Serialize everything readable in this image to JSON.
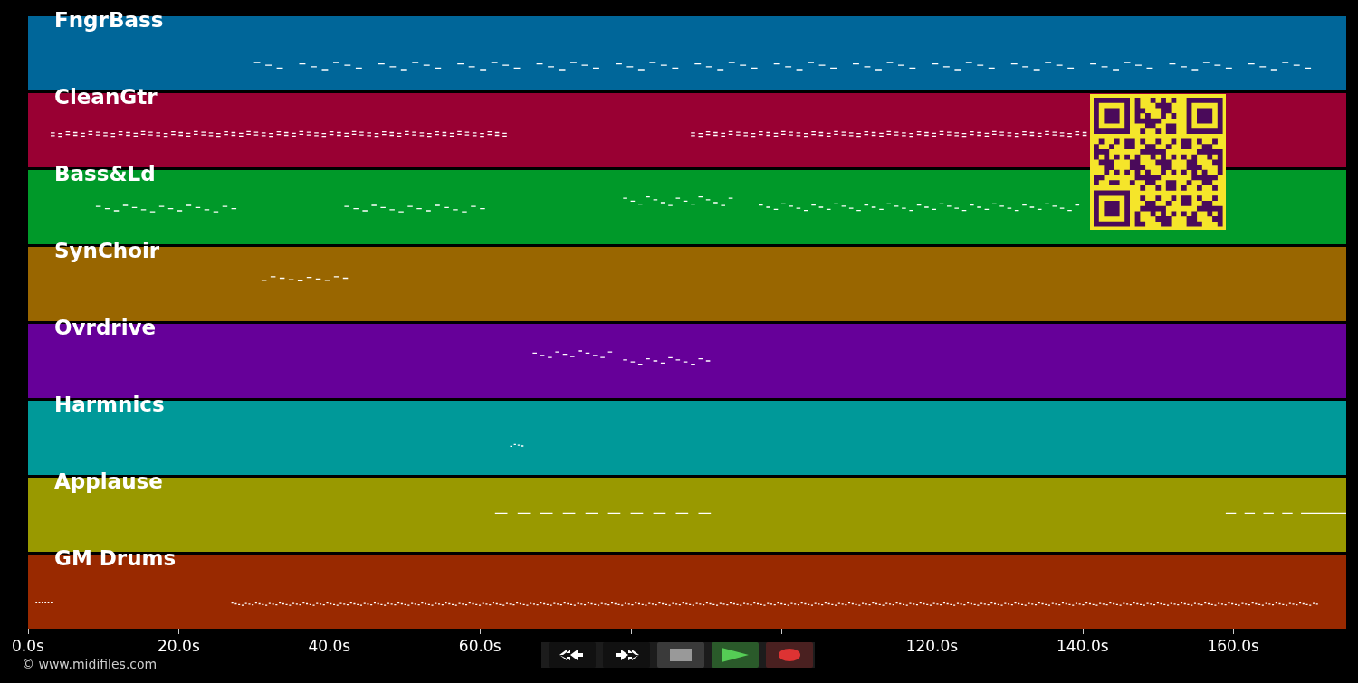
{
  "tracks": [
    {
      "name": "FngrBass",
      "color": "#006699"
    },
    {
      "name": "CleanGtr",
      "color": "#990033"
    },
    {
      "name": "Bass&Ld",
      "color": "#009929"
    },
    {
      "name": "SynChoir",
      "color": "#996600"
    },
    {
      "name": "Ovrdrive",
      "color": "#660099"
    },
    {
      "name": "Harmnics",
      "color": "#009999"
    },
    {
      "name": "Applause",
      "color": "#999900"
    },
    {
      "name": "GM Drums",
      "color": "#992900"
    }
  ],
  "axis": {
    "left_ticks": [
      "0.0s",
      "20.0s",
      "40.0s",
      "60.0s"
    ],
    "right_ticks": [
      "120.0s",
      "140.0s",
      "160.0s"
    ]
  },
  "transport": [
    {
      "kind": "rewind"
    },
    {
      "kind": "forward"
    },
    {
      "kind": "stop"
    },
    {
      "kind": "play"
    },
    {
      "kind": "record"
    }
  ],
  "footer": "© www.midifiles.com"
}
